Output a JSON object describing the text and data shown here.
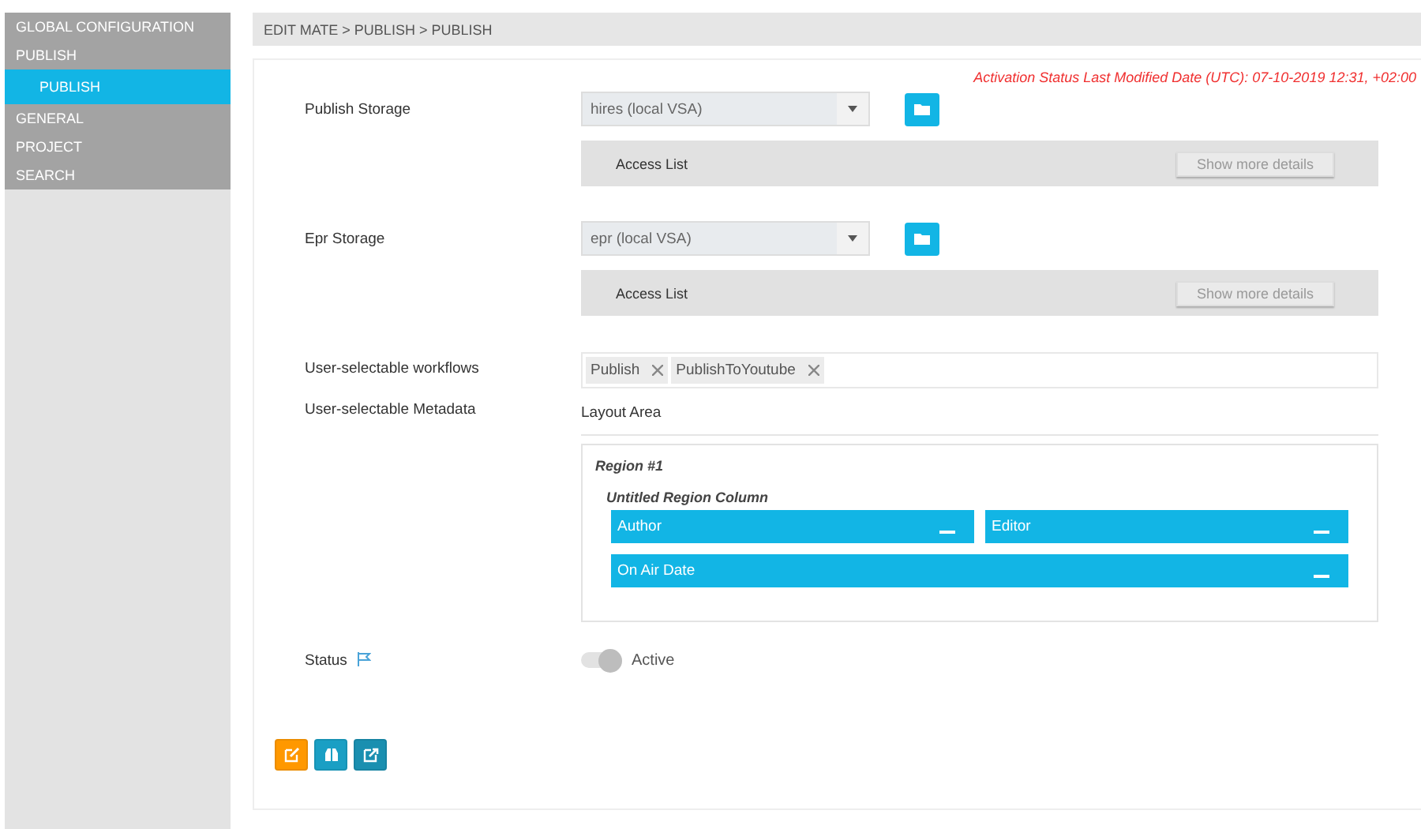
{
  "sidebar": {
    "items": [
      {
        "label": "GLOBAL CONFIGURATION",
        "selected": false
      },
      {
        "label": "PUBLISH",
        "selected": false,
        "children": [
          {
            "label": "PUBLISH",
            "selected": true
          }
        ]
      },
      {
        "label": "GENERAL",
        "selected": false
      },
      {
        "label": "PROJECT",
        "selected": false
      },
      {
        "label": "SEARCH",
        "selected": false
      }
    ]
  },
  "breadcrumb": "EDIT MATE > PUBLISH > PUBLISH",
  "activation_note": "Activation Status Last Modified Date (UTC): 07-10-2019 12:31, +02:00",
  "storages": [
    {
      "label": "Publish Storage",
      "value": "hires (local VSA)",
      "access_label": "Access List",
      "details_button": "Show more details"
    },
    {
      "label": "Epr Storage",
      "value": "epr (local VSA)",
      "access_label": "Access List",
      "details_button": "Show more details"
    }
  ],
  "workflows": {
    "label": "User-selectable workflows",
    "tags": [
      "Publish",
      "PublishToYoutube"
    ]
  },
  "metadata": {
    "label": "User-selectable Metadata",
    "layout_title": "Layout Area",
    "region_title": "Region #1",
    "column_title": "Untitled Region Column",
    "rows": [
      [
        "Author",
        "Editor"
      ],
      [
        "On Air Date"
      ]
    ]
  },
  "status": {
    "label": "Status",
    "toggle_label": "Active",
    "on": true,
    "disabled": true
  },
  "actions": [
    {
      "kind": "edit",
      "color": "#ff9800"
    },
    {
      "kind": "binoculars",
      "color": "#1a9fc4"
    },
    {
      "kind": "open",
      "color": "#1a8fb0"
    }
  ]
}
